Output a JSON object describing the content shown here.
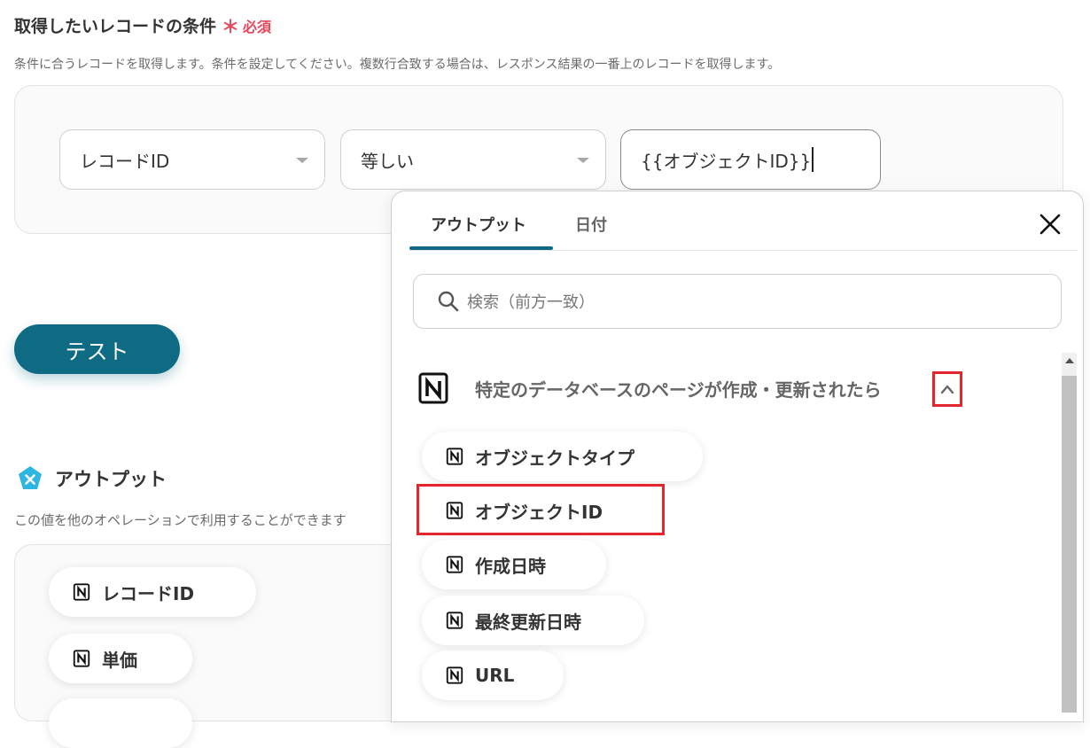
{
  "condition": {
    "title": "取得したいレコードの条件",
    "required_mark": "＊",
    "required_label": "必須",
    "description": "条件に合うレコードを取得します。条件を設定してください。複数行合致する場合は、レスポンス結果の一番上のレコードを取得します。",
    "field_select": "レコードID",
    "operator_select": "等しい",
    "value": "{{オブジェクトID}}"
  },
  "test_button": "テスト",
  "output": {
    "title": "アウトプット",
    "description": "この値を他のオペレーションで利用することができます",
    "chips": [
      "レコードID",
      "単価"
    ]
  },
  "picker": {
    "tabs": [
      "アウトプット",
      "日付"
    ],
    "search_placeholder": "検索（前方一致）",
    "group_title": "特定のデータベースのページが作成・更新されたら",
    "items": [
      "オブジェクトタイプ",
      "オブジェクトID",
      "作成日時",
      "最終更新日時",
      "URL"
    ]
  },
  "colors": {
    "accent": "#0f6b84",
    "required": "#e5475b",
    "highlight": "#e4262c",
    "output_icon": "#2fb6e0"
  }
}
